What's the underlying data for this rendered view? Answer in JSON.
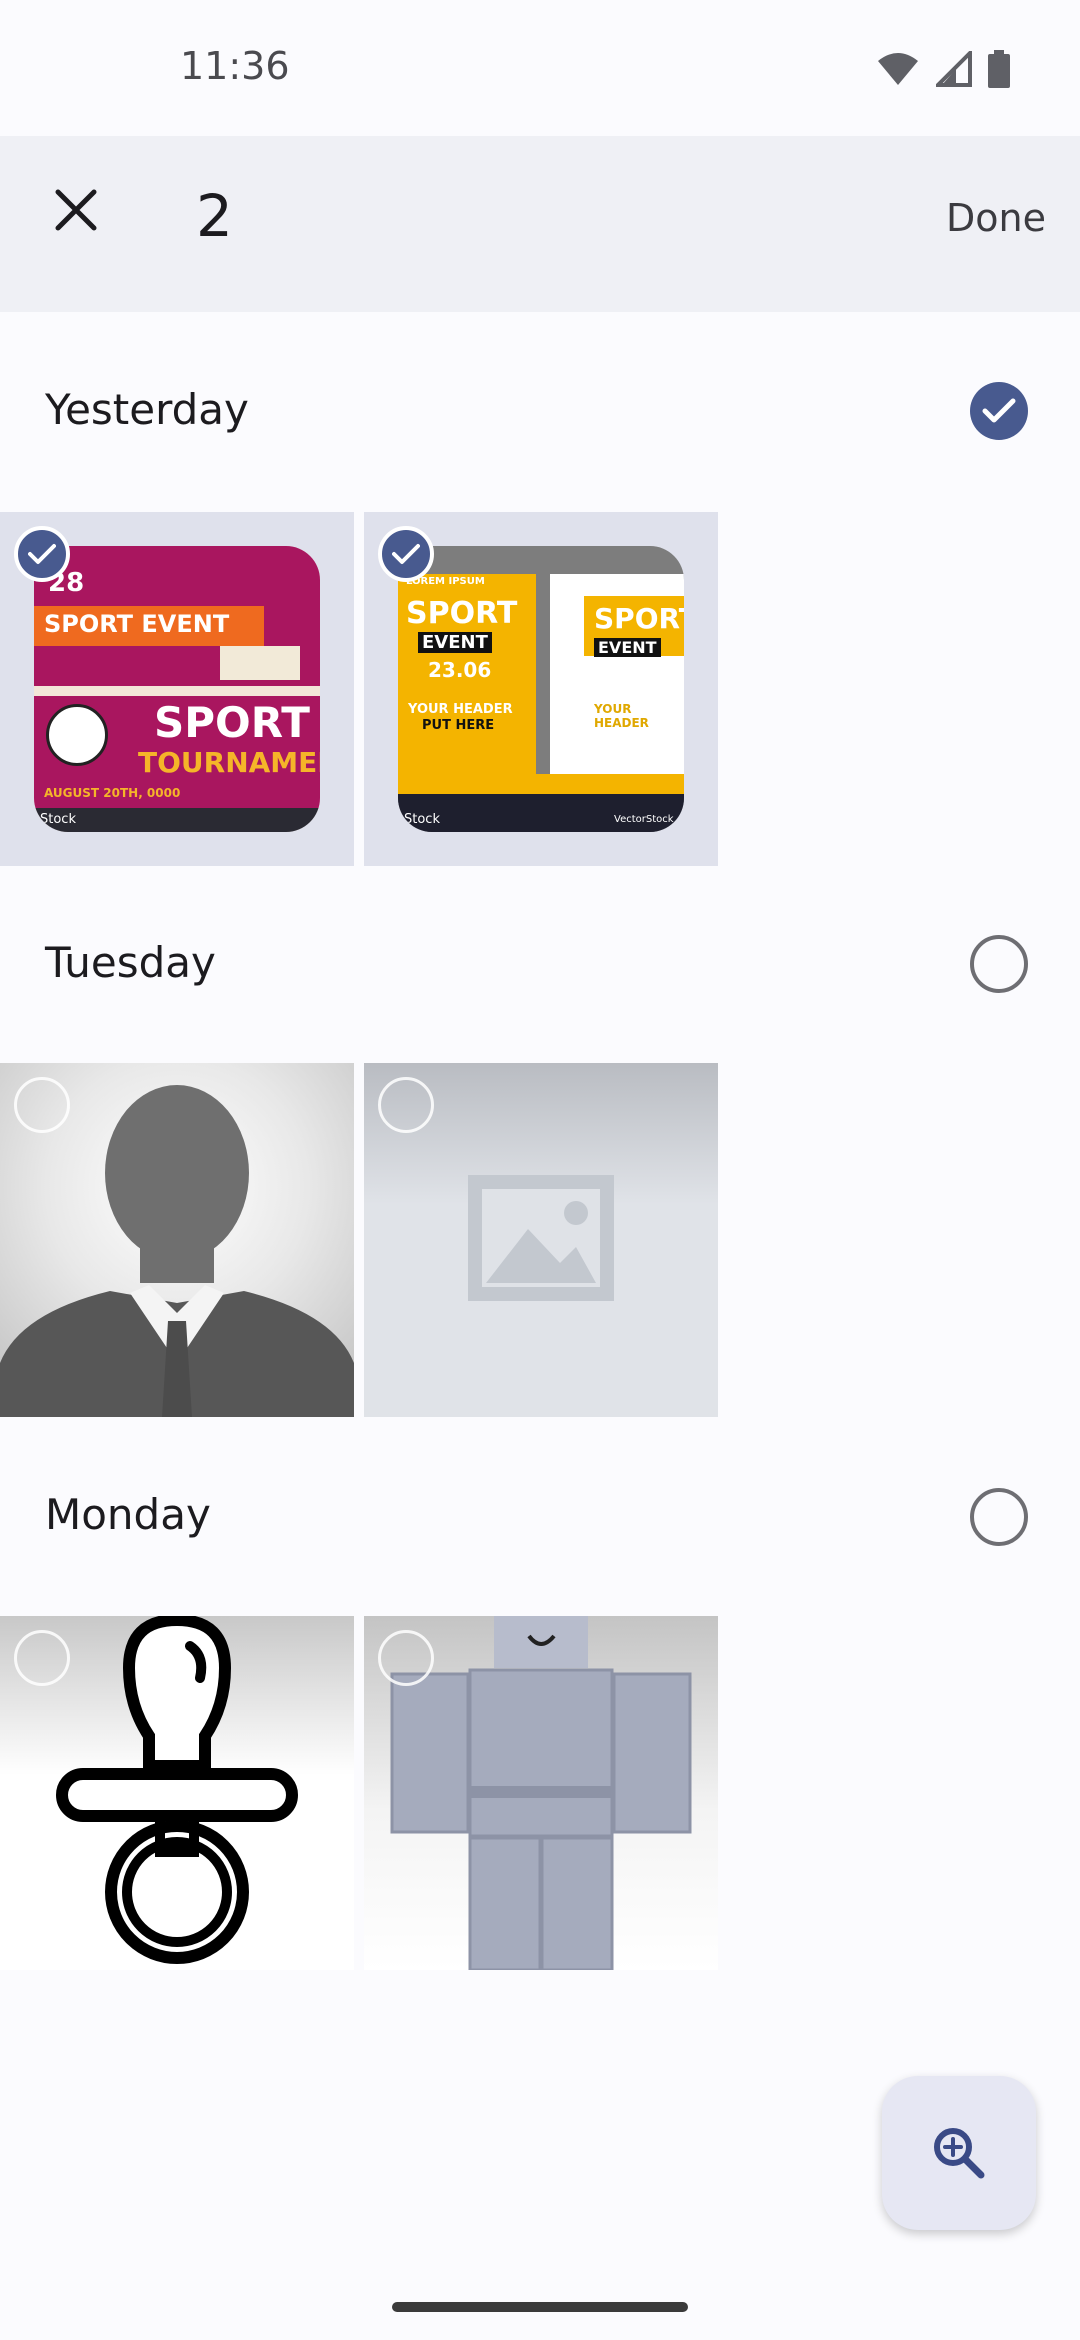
{
  "status_bar": {
    "time": "11:36"
  },
  "selection_bar": {
    "count": "2",
    "done_label": "Done"
  },
  "sections": [
    {
      "title": "Yesterday",
      "selected": true
    },
    {
      "title": "Tuesday",
      "selected": false
    },
    {
      "title": "Monday",
      "selected": false
    }
  ],
  "posters": {
    "poster1": {
      "date": "28",
      "heading": "SPORT EVENT",
      "title1": "SPORT",
      "title2": "TOURNAMENT",
      "footer": "AUGUST 20TH, 0000",
      "brand": "Stock"
    },
    "poster2": {
      "eyebrow": "LOREM IPSUM",
      "title": "SPORT",
      "subtitle": "EVENT",
      "date": "23.06",
      "header": "YOUR HEADER",
      "sub": "PUT HERE",
      "brand": "Stock",
      "credit": "VectorStock"
    }
  },
  "fab": {
    "icon": "zoom-in-icon"
  },
  "colors": {
    "accent": "#485a8f",
    "topbar": "#eff0f5",
    "background": "#fbfbfe"
  }
}
